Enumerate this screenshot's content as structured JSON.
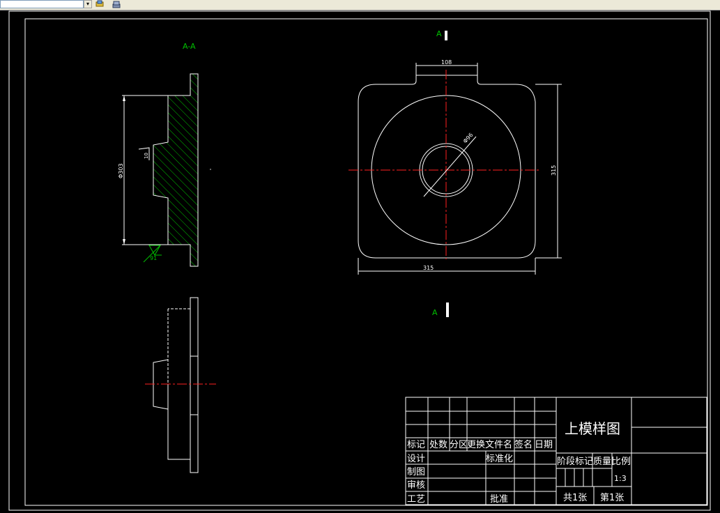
{
  "toolbar": {
    "combo_value": "",
    "icons": [
      "layers-icon",
      "stack-icon"
    ]
  },
  "section_label": "A-A",
  "view_label_top": "A",
  "view_label_bottom": "A",
  "dims": {
    "top_width": "108",
    "diameter_hole": "Φ96",
    "height": "315",
    "width": "315",
    "left_diameter": "Φ303",
    "left_small": "10",
    "surface": "91"
  },
  "title_block": {
    "title": "上模样图",
    "headers": [
      "标记",
      "处数",
      "分区",
      "更换文件名",
      "签名",
      "日期"
    ],
    "row_design": "设计",
    "row_drawing": "制图",
    "row_review": "审核",
    "row_process": "工艺",
    "standardize": "标准化",
    "approve": "批准",
    "stage_mark": "阶段标记",
    "weight": "质量",
    "scale_label": "比例",
    "scale_value": "1:3",
    "total_sheets": "共1张",
    "sheet_no": "第1张"
  },
  "colors": {
    "background": "#000000",
    "lines": "#ffffff",
    "center": "#ff2020",
    "hatch": "#00c000"
  }
}
